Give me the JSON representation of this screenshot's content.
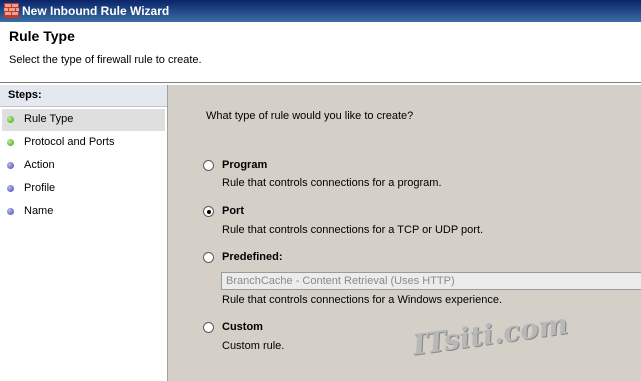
{
  "window": {
    "title": "New Inbound Rule Wizard"
  },
  "header": {
    "title": "Rule Type",
    "subtitle": "Select the type of firewall rule to create."
  },
  "steps": {
    "label": "Steps:",
    "items": [
      {
        "label": "Rule Type",
        "status": "green",
        "active": true
      },
      {
        "label": "Protocol and Ports",
        "status": "green"
      },
      {
        "label": "Action",
        "status": "blue"
      },
      {
        "label": "Profile",
        "status": "blue"
      },
      {
        "label": "Name",
        "status": "blue"
      }
    ]
  },
  "main": {
    "question": "What type of rule would you like to create?",
    "options": [
      {
        "label": "Program",
        "description": "Rule that controls connections for a program.",
        "selected": false
      },
      {
        "label": "Port",
        "description": "Rule that controls connections for a TCP or UDP port.",
        "selected": true
      },
      {
        "label": "Predefined:",
        "dropdown_value": "BranchCache - Content Retrieval (Uses HTTP)",
        "description": "Rule that controls connections for a Windows experience.",
        "selected": false
      },
      {
        "label": "Custom",
        "description": "Custom rule.",
        "selected": false
      }
    ]
  },
  "watermark": "ITsiti.com",
  "colors": {
    "titlebar_start": "#0a246a",
    "titlebar_end": "#3a6ea5",
    "step_done": "#3c9d1c",
    "step_pending": "#4646a8"
  }
}
